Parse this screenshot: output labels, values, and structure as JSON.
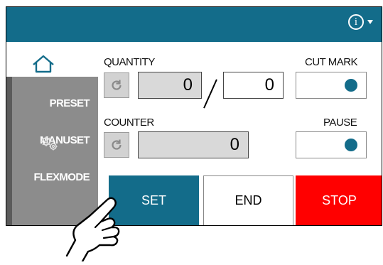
{
  "colors": {
    "header": "#136c8a",
    "sidebar": "#8c8c8c",
    "stop": "#ff0000",
    "toggle_dot": "#136c8a"
  },
  "header": {
    "info_icon": "info-icon",
    "menu_icon": "caret-down-icon"
  },
  "sidebar": {
    "home_icon": "home-icon",
    "items": [
      {
        "label": "PRESET"
      },
      {
        "label": "MANUSET"
      },
      {
        "label": "FLEXMODE"
      }
    ],
    "settings_icon": "gears-icon"
  },
  "quantity": {
    "label": "QUANTITY",
    "current": "0",
    "target": "0"
  },
  "counter": {
    "label": "COUNTER",
    "value": "0"
  },
  "cut_mark": {
    "label": "CUT MARK",
    "enabled": true
  },
  "pause": {
    "label": "PAUSE",
    "enabled": true
  },
  "actions": {
    "set": "SET",
    "end": "END",
    "stop": "STOP"
  }
}
